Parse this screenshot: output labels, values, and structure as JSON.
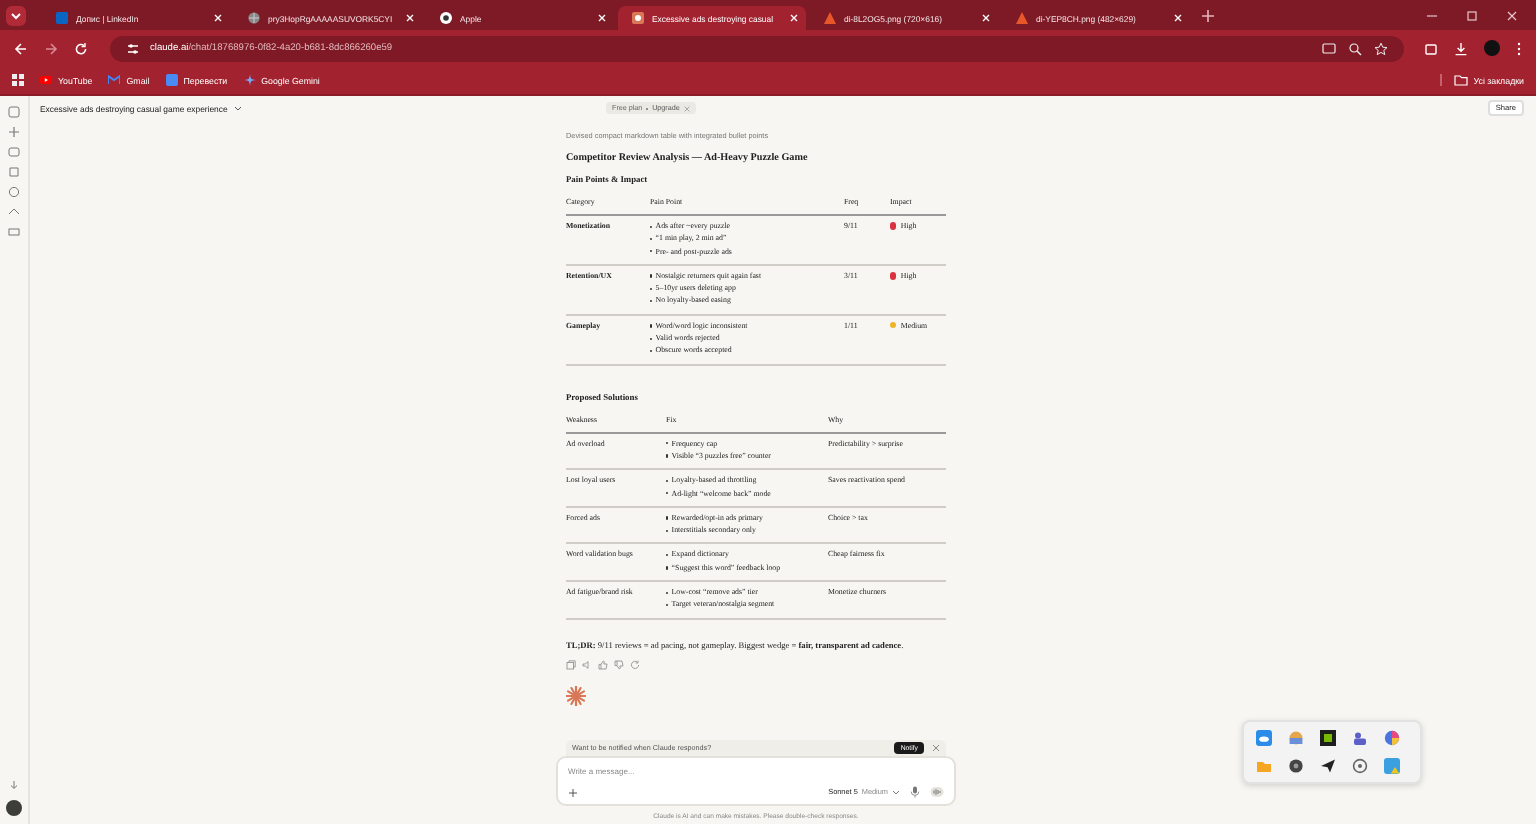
{
  "browser": {
    "tabs": [
      {
        "title": "Допис | LinkedIn",
        "kind": "square",
        "selected": false
      },
      {
        "title": "pry3HopRgAAAAASUVORK5CYI",
        "kind": "globe",
        "selected": false
      },
      {
        "title": "Apple",
        "kind": "circle",
        "selected": false
      },
      {
        "title": "Excessive ads destroying casual",
        "kind": "page",
        "selected": true
      },
      {
        "title": "di-8L2OG5.png (720×616)",
        "kind": "image",
        "selected": false
      },
      {
        "title": "di-YEP8CH.png (482×629)",
        "kind": "image",
        "selected": false
      }
    ],
    "url_host": "claude.ai",
    "url_path": "/chat/18768976-0f82-4a20-b681-8dc866260e59",
    "bookmarks": [
      "YouTube",
      "Gmail",
      "Перевести",
      "Google Gemini"
    ],
    "all_bookmarks": "Усі закладки"
  },
  "chat": {
    "title": "Excessive ads destroying casual game experience",
    "plan": "Free plan",
    "upgrade": "Upgrade",
    "share": "Share"
  },
  "response": {
    "thinking": "Devised compact markdown table with integrated bullet points",
    "heading": "Competitor Review Analysis — Ad-Heavy Puzzle Game",
    "pain": {
      "title": "Pain Points & Impact",
      "columns": [
        "Category",
        "Pain Point",
        "Freq",
        "Impact"
      ],
      "rows": [
        {
          "category": "Monetization",
          "points": [
            "Ads after ~every puzzle",
            "“1 min play, 2 min ad”",
            "Pre- and post-puzzle ads"
          ],
          "freq": "9/11",
          "impact": "High",
          "color": "#d9333f"
        },
        {
          "category": "Retention/UX",
          "points": [
            "Nostalgic returners quit again fast",
            "5–10yr users deleting app",
            "No loyalty-based easing"
          ],
          "freq": "3/11",
          "impact": "High",
          "color": "#d9333f"
        },
        {
          "category": "Gameplay",
          "points": [
            "Word/word logic inconsistent",
            "Valid words rejected",
            "Obscure words accepted"
          ],
          "freq": "1/11",
          "impact": "Medium",
          "color": "#f0b429"
        }
      ]
    },
    "solutions": {
      "title": "Proposed Solutions",
      "columns": [
        "Weakness",
        "Fix",
        "Why"
      ],
      "rows": [
        {
          "weakness": "Ad overload",
          "fixes": [
            "Frequency cap",
            "Visible “3 puzzles free” counter"
          ],
          "why": "Predictability > surprise"
        },
        {
          "weakness": "Lost loyal users",
          "fixes": [
            "Loyalty-based ad throttling",
            "Ad-light “welcome back” mode"
          ],
          "why": "Saves reactivation spend"
        },
        {
          "weakness": "Forced ads",
          "fixes": [
            "Rewarded/opt-in ads primary",
            "Interstitials secondary only"
          ],
          "why": "Choice > tax"
        },
        {
          "weakness": "Word validation bugs",
          "fixes": [
            "Expand dictionary",
            "“Suggest this word” feedback loop"
          ],
          "why": "Cheap fairness fix"
        },
        {
          "weakness": "Ad fatigue/brand risk",
          "fixes": [
            "Low-cost “remove ads” tier",
            "Target veteran/nostalgia segment"
          ],
          "why": "Monetize churners"
        }
      ]
    },
    "tldr": "**TL;DR:** 9/11 reviews = ad pacing, not gameplay. Biggest wedge = **fair, transparent ad cadence**."
  },
  "notify": {
    "text": "Want to be notified when Claude responds?",
    "button": "Notify"
  },
  "composer": {
    "placeholder": "Write a message...",
    "model": "Sonnet 5",
    "effort": "Medium"
  },
  "footer": "Claude is AI and can make mistakes. Please double-check responses."
}
